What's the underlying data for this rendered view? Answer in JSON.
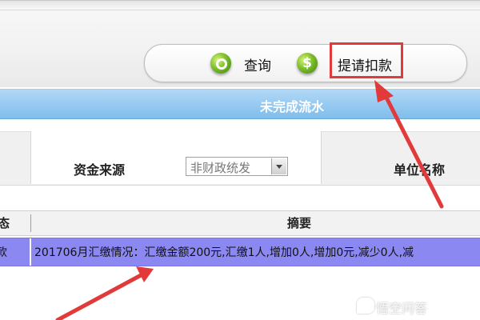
{
  "toolbar": {
    "query_label": "查询",
    "deduct_label": "提请扣款",
    "query_icon": "search-icon",
    "deduct_icon": "dollar-icon"
  },
  "title_bar": {
    "title": "未完成流水"
  },
  "filters": {
    "source_label": "资金来源",
    "source_value": "非财政统发",
    "unit_label": "单位名称"
  },
  "grid": {
    "columns": [
      "态",
      "摘要"
    ],
    "rows": [
      {
        "status": "款",
        "summary": "201706月汇缴情况：汇缴金额200元,汇缴1人,增加0人,增加0元,减少0人,减"
      }
    ]
  },
  "colors": {
    "title_bar": "#8ec8f0",
    "selected_row": "#8c88f2",
    "annotation_red": "#e23a3a"
  },
  "watermark": {
    "text": "悟空问答"
  }
}
